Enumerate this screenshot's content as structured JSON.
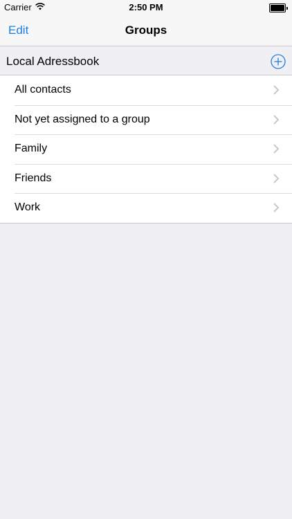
{
  "status_bar": {
    "carrier": "Carrier",
    "time": "2:50 PM"
  },
  "nav": {
    "edit_label": "Edit",
    "title": "Groups"
  },
  "section": {
    "title": "Local Adressbook"
  },
  "groups": [
    {
      "label": "All contacts"
    },
    {
      "label": "Not yet assigned to a group"
    },
    {
      "label": "Family"
    },
    {
      "label": "Friends"
    },
    {
      "label": "Work"
    }
  ],
  "colors": {
    "accent": "#1a7fe0",
    "background": "#efeff4",
    "chevron": "#c7c7cc"
  },
  "icons": {
    "wifi": "wifi-icon",
    "battery": "battery-icon",
    "add": "plus-circle-icon",
    "disclosure": "chevron-right-icon"
  }
}
